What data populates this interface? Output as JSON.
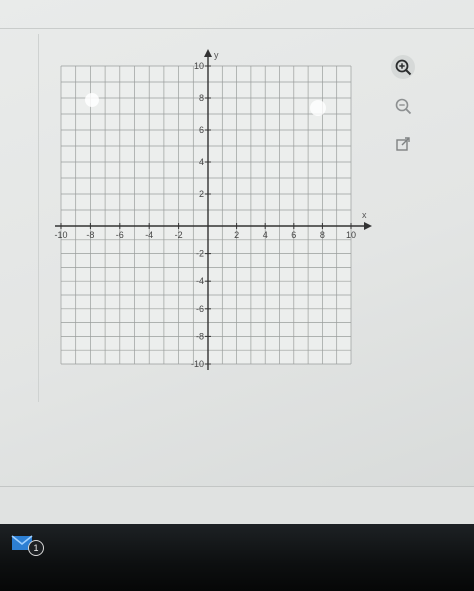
{
  "graph": {
    "x_axis_name": "x",
    "y_axis_name": "y",
    "x_min": -10,
    "x_max": 10,
    "y_min": -10,
    "y_max": 10,
    "grid_step": 1,
    "x_tick_labels": [
      {
        "value": -10,
        "text": "-10"
      },
      {
        "value": -8,
        "text": "-8"
      },
      {
        "value": -6,
        "text": "-6"
      },
      {
        "value": -4,
        "text": "-4"
      },
      {
        "value": -2,
        "text": "-2"
      },
      {
        "value": 2,
        "text": "2"
      },
      {
        "value": 4,
        "text": "4"
      },
      {
        "value": 6,
        "text": "6"
      },
      {
        "value": 8,
        "text": "8"
      },
      {
        "value": 10,
        "text": "10"
      }
    ],
    "y_tick_labels": [
      {
        "value": 10,
        "text": "10"
      },
      {
        "value": 8,
        "text": "8"
      },
      {
        "value": 6,
        "text": "6"
      },
      {
        "value": 4,
        "text": "4"
      },
      {
        "value": 2,
        "text": "2"
      },
      {
        "value": -2,
        "text": "-2"
      },
      {
        "value": -4,
        "text": "-4"
      },
      {
        "value": -6,
        "text": "-6"
      },
      {
        "value": -8,
        "text": "-8"
      },
      {
        "value": -10,
        "text": "-10"
      }
    ],
    "colors": {
      "grid": "#9a9d9c",
      "axis": "#333333"
    }
  },
  "toolbar": {
    "zoom_in_icon": "zoom-in-icon",
    "zoom_out_icon": "zoom-out-icon",
    "external_link_icon": "external-link-icon"
  },
  "taskbar": {
    "mail_icon": "mail-icon",
    "mail_badge_count": "1"
  }
}
